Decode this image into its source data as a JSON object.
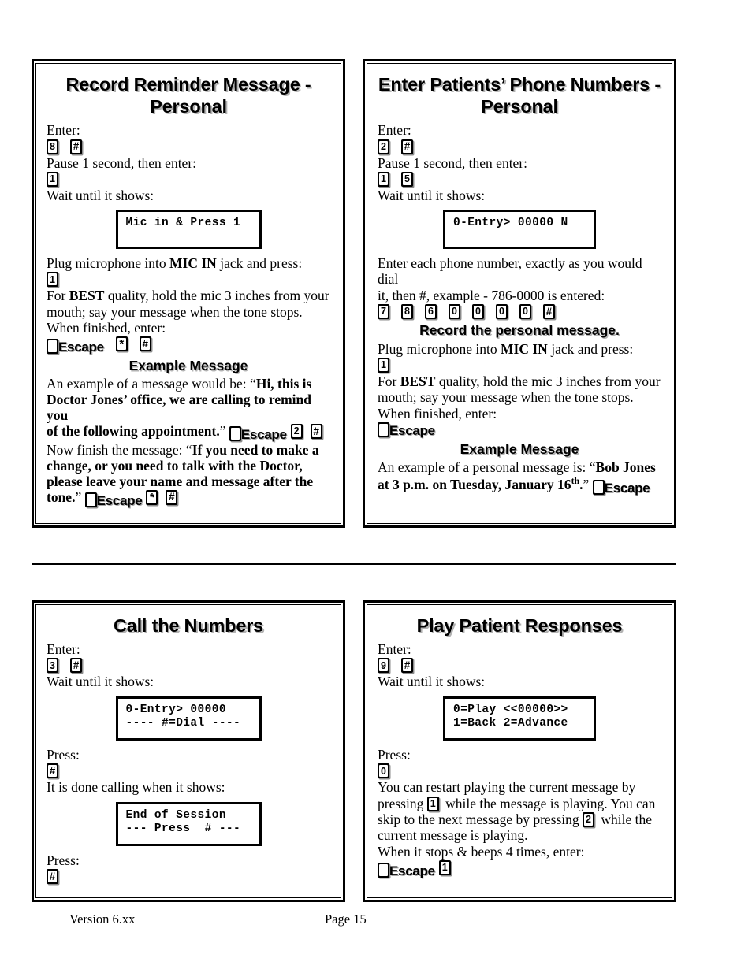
{
  "document": {
    "footer": {
      "version": "Version 6.xx",
      "page": "Page 15"
    }
  },
  "panels": {
    "record_reminder": {
      "title": "Record Reminder Message - Personal",
      "l_enter": "Enter:",
      "keys_1": [
        "8",
        "#"
      ],
      "l_pause": "Pause 1 second, then enter:",
      "keys_2": [
        "1"
      ],
      "l_wait": "Wait until it shows:",
      "lcd": [
        "Mic in & Press 1"
      ],
      "l_plug_pre": "Plug microphone into ",
      "l_plug_bold": "MIC IN",
      "l_plug_post": " jack and press:",
      "keys_3": [
        "1"
      ],
      "l_best_pre": "For ",
      "l_best_bold": "BEST",
      "l_best_post": " quality, hold the mic 3 inches from your",
      "l_best_line2": "mouth; say your message when the tone stops.",
      "l_finished": "When finished, enter:",
      "escape_label": "Escape",
      "keys_4": [
        "*",
        "#"
      ],
      "subhead": "Example Message",
      "ex_intro": "An example of a message would be:  “",
      "ex_bold_1": "Hi, this is",
      "ex_bold_2": "Doctor Jones’ office, we are calling to remind you",
      "ex_bold_3": "of the following appointment.",
      "ex_close_1": "”",
      "ex_keys_1": [
        "2",
        "#"
      ],
      "ex_now": "Now finish the message:  “",
      "ex_bold_4": "If you need to make a",
      "ex_bold_5": "change, or you need to talk with the Doctor,",
      "ex_bold_6": "please leave your name and message after the",
      "ex_bold_7": "tone.",
      "ex_close_2": "”",
      "ex_keys_2": [
        "*",
        "#"
      ]
    },
    "enter_phone": {
      "title": "Enter Patients’ Phone Numbers - Personal",
      "l_enter": "Enter:",
      "keys_1": [
        "2",
        "#"
      ],
      "l_pause": "Pause 1 second, then enter:",
      "keys_2": [
        "1",
        "5"
      ],
      "l_wait": "Wait until it shows:",
      "lcd": [
        "0-Entry> 00000 N"
      ],
      "l_each_1": "Enter each phone number, exactly as you would dial",
      "l_each_2": "it, then #, example - 786-0000 is entered:",
      "keys_phone": [
        "7",
        "8",
        "6",
        "0",
        "0",
        "0",
        "0",
        "#"
      ],
      "subhead_1": "Record the personal message.",
      "l_plug_pre": "Plug microphone into ",
      "l_plug_bold": "MIC IN",
      "l_plug_post": " jack and press:",
      "keys_3": [
        "1"
      ],
      "l_best_pre": "For ",
      "l_best_bold": "BEST",
      "l_best_post": " quality, hold the mic 3 inches from your",
      "l_best_line2": "mouth; say your message when the tone stops.",
      "l_finished": "When finished, enter:",
      "escape_label": "Escape",
      "subhead_2": "Example Message",
      "ex_intro": "An example of a personal message is:  “",
      "ex_bold_1": "Bob Jones",
      "ex_bold_2": "at 3 p.m. on Tuesday, January 16",
      "ex_bold_sup": "th",
      "ex_bold_3": ".",
      "ex_close": "”",
      "escape_label_2": "Escape"
    },
    "call_numbers": {
      "title": "Call the Numbers",
      "l_enter": "Enter:",
      "keys_1": [
        "3",
        "#"
      ],
      "l_wait": "Wait until it shows:",
      "lcd_1": [
        "0-Entry> 00000",
        "---- #=Dial ----"
      ],
      "l_press_1": "Press:",
      "keys_2": [
        "#"
      ],
      "l_done": "It is done calling when it shows:",
      "lcd_2": [
        "End of Session",
        "--- Press  # ---"
      ],
      "l_press_2": "Press:",
      "keys_3": [
        "#"
      ]
    },
    "play_responses": {
      "title": "Play Patient Responses",
      "l_enter": "Enter:",
      "keys_1": [
        "9",
        "#"
      ],
      "l_wait": "Wait until it shows:",
      "lcd": [
        "0=Play <<00000>>",
        "1=Back 2=Advance"
      ],
      "l_press": "Press:",
      "keys_2": [
        "0"
      ],
      "l_restart_1": "You can restart playing the current message by",
      "l_restart_2a": "pressing ",
      "l_restart_key_1": "1",
      "l_restart_2b": " while the message is playing.  You can",
      "l_restart_3a": "skip to the next message by pressing ",
      "l_restart_key_2": "2",
      "l_restart_3b": " while the",
      "l_restart_4": "current message is playing.",
      "l_beeps": "When it stops & beeps 4 times, enter:",
      "escape_label": "Escape",
      "keys_3": [
        "1"
      ]
    }
  }
}
